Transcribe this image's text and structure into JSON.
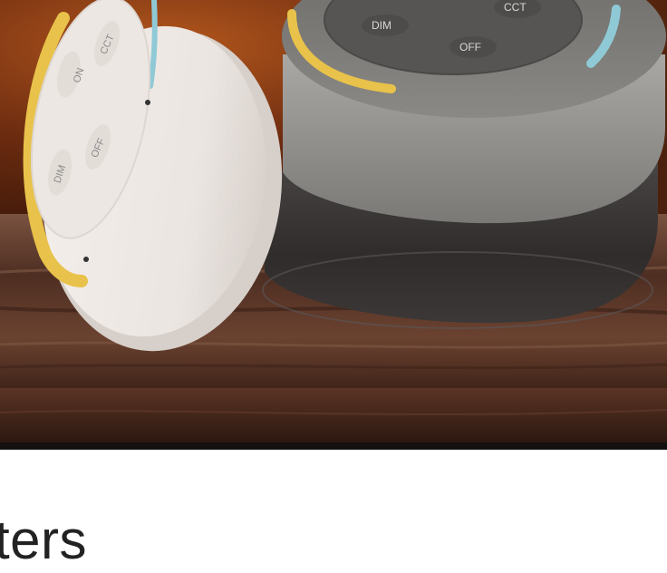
{
  "photo": {
    "grey_remote_buttons": [
      "DIM",
      "CCT",
      "OFF"
    ],
    "white_remote_buttons": [
      "ON",
      "CCT",
      "DIM",
      "OFF"
    ],
    "colors": {
      "warm_ring": "#e8c24a",
      "cool_ring": "#8fc9d6",
      "wood": "#5a3422",
      "background": "#6a2e12"
    }
  },
  "caption": {
    "text": "ters"
  }
}
